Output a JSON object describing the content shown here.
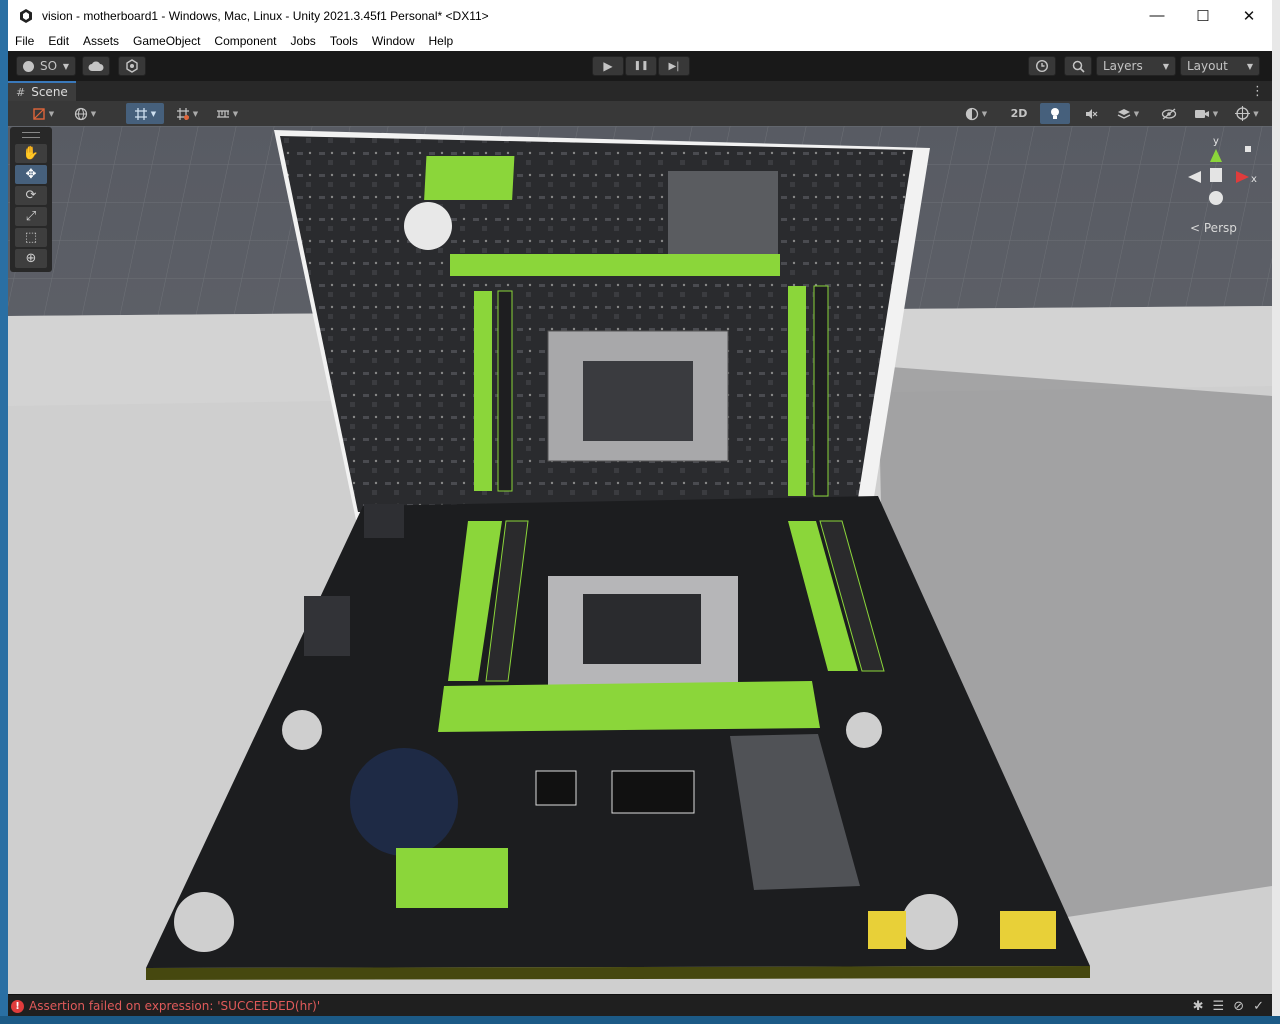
{
  "window": {
    "title": "vision - motherboard1 - Windows, Mac, Linux - Unity 2021.3.45f1 Personal* <DX11>",
    "minimize_symbol": "—",
    "maximize_symbol": "☐",
    "close_symbol": "✕"
  },
  "menu": {
    "items": [
      "File",
      "Edit",
      "Assets",
      "GameObject",
      "Component",
      "Jobs",
      "Tools",
      "Window",
      "Help"
    ]
  },
  "toolbar": {
    "account_label": "SO",
    "play_symbol": "▶",
    "pause_symbol": "❚❚",
    "step_symbol": "▶|",
    "layers_label": "Layers",
    "layout_label": "Layout"
  },
  "scene_tab": {
    "label": "Scene"
  },
  "scene_toolbar": {
    "mode_2d_label": "2D"
  },
  "gizmo": {
    "y_label": "y",
    "x_label": "x",
    "persp_label": "Persp"
  },
  "status": {
    "error_symbol": "!",
    "message": "Assertion failed on expression: 'SUCCEEDED(hr)'"
  },
  "colors": {
    "accent": "#46607c",
    "error": "#e05a5a",
    "board_green": "#8bd63a"
  }
}
